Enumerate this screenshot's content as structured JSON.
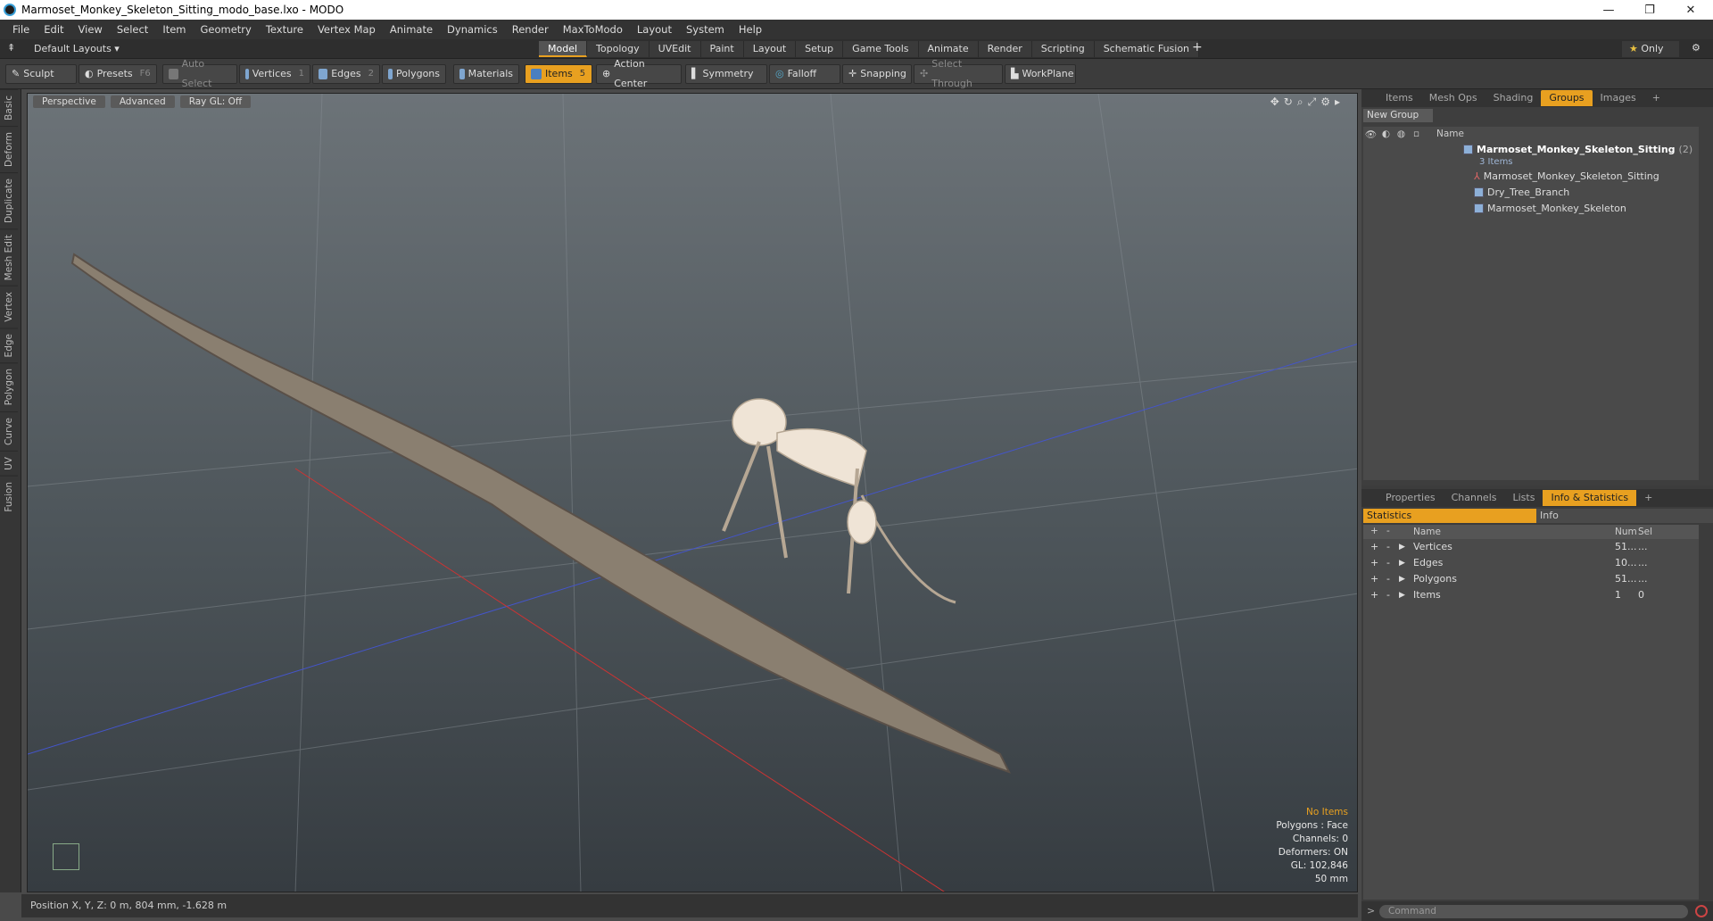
{
  "window": {
    "title": "Marmoset_Monkey_Skeleton_Sitting_modo_base.lxo - MODO"
  },
  "menu": [
    "File",
    "Edit",
    "View",
    "Select",
    "Item",
    "Geometry",
    "Texture",
    "Vertex Map",
    "Animate",
    "Dynamics",
    "Render",
    "MaxToModo",
    "Layout",
    "System",
    "Help"
  ],
  "layouts": {
    "label": "Default Layouts ▾"
  },
  "main_tabs": [
    "Model",
    "Topology",
    "UVEdit",
    "Paint",
    "Layout",
    "Setup",
    "Game Tools",
    "Animate",
    "Render",
    "Scripting",
    "Schematic Fusion"
  ],
  "only_label": "Only",
  "toolbar": {
    "sculpt": "Sculpt",
    "presets": "Presets",
    "presets_key": "F6",
    "auto_select": "Auto Select",
    "vertices": "Vertices",
    "vertices_num": "1",
    "edges": "Edges",
    "edges_num": "2",
    "polygons": "Polygons",
    "materials": "Materials",
    "items": "Items",
    "items_num": "5",
    "action_center": "Action Center",
    "symmetry": "Symmetry",
    "falloff": "Falloff",
    "snapping": "Snapping",
    "select_through": "Select Through",
    "workplane": "WorkPlane"
  },
  "left_tabs": [
    "Basic",
    "Deform",
    "Duplicate",
    "Mesh Edit",
    "Vertex",
    "Edge",
    "Polygon",
    "Curve",
    "UV",
    "Fusion"
  ],
  "viewport": {
    "view": "Perspective",
    "advanced": "Advanced",
    "raygl": "Ray GL: Off",
    "stats": {
      "no_items": "No Items",
      "polygons": "Polygons : Face",
      "channels": "Channels: 0",
      "deformers": "Deformers: ON",
      "gl": "GL: 102,846",
      "scale": "50 mm"
    }
  },
  "status": {
    "position": "Position X, Y, Z:  0 m, 804 mm, -1.628 m"
  },
  "panel_tabs": [
    "Items",
    "Mesh Ops",
    "Shading",
    "Groups",
    "Images"
  ],
  "groups": {
    "new_group": "New Group",
    "name_header": "Name",
    "root": "Marmoset_Monkey_Skeleton_Sitting",
    "root_count": "(2)",
    "root_sub": "3 Items",
    "children": [
      "Marmoset_Monkey_Skeleton_Sitting",
      "Dry_Tree_Branch",
      "Marmoset_Monkey_Skeleton"
    ]
  },
  "info_tabs": [
    "Properties",
    "Channels",
    "Lists",
    "Info & Statistics"
  ],
  "stats": {
    "tab_statistics": "Statistics",
    "tab_info": "Info",
    "headers": {
      "name": "Name",
      "num": "Num",
      "sel": "Sel"
    },
    "rows": [
      {
        "name": "Vertices",
        "num": "51...",
        "sel": "..."
      },
      {
        "name": "Edges",
        "num": "10...",
        "sel": "..."
      },
      {
        "name": "Polygons",
        "num": "51...",
        "sel": "..."
      },
      {
        "name": "Items",
        "num": "1",
        "sel": "0"
      }
    ]
  },
  "command": {
    "placeholder": "Command"
  }
}
